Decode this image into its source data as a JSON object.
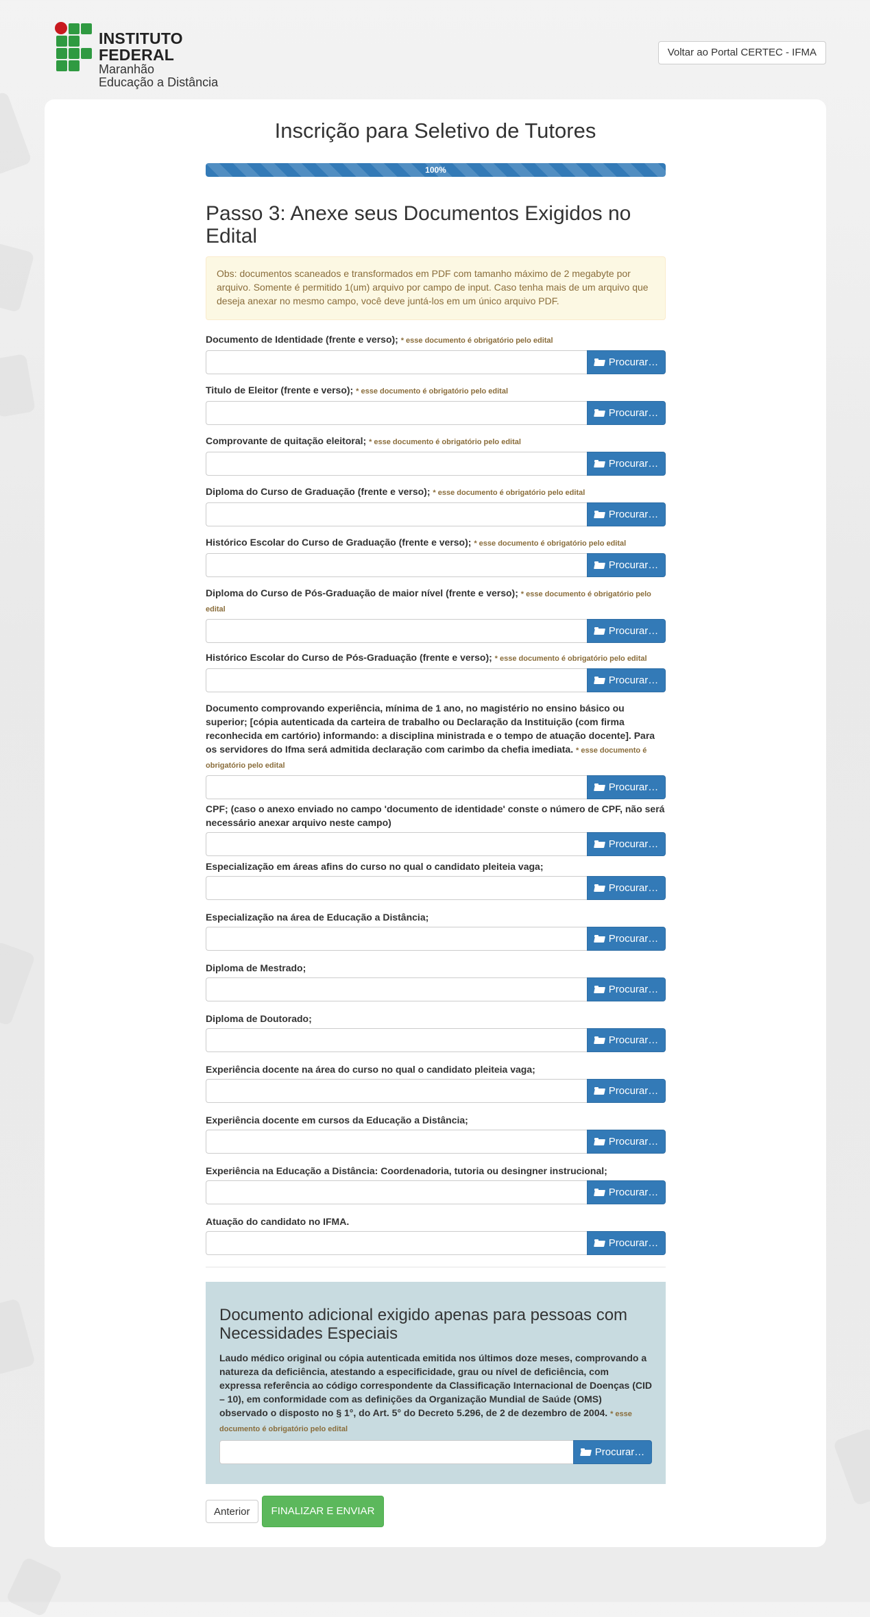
{
  "header": {
    "logo": {
      "title": "INSTITUTO FEDERAL",
      "line1": "Maranhão",
      "line2": "Educação a Distância"
    },
    "portal_button": "Voltar ao Portal CERTEC - IFMA"
  },
  "form": {
    "title": "Inscrição para Seletivo de Tutores",
    "progress": {
      "label": "100%",
      "percent": 100
    },
    "step_title": "Passo 3: Anexe seus Documentos Exigidos no Edital",
    "notice": "Obs: documentos scaneados e transformados em PDF com tamanho máximo de 2 megabyte por arquivo. Somente é permitido 1(um) arquivo por campo de input. Caso tenha mais de um arquivo que deseja anexar no mesmo campo, você deve juntá-los em um único arquivo PDF.",
    "browse_label": "Procurar…",
    "required_note": "* esse documento é obrigatório pelo edital",
    "fields": [
      {
        "label": "Documento de Identidade (frente e verso);",
        "note": "* esse documento é obrigatório pelo edital"
      },
      {
        "label": "Titulo de Eleitor (frente e verso);",
        "note": "* esse documento é obrigatório pelo edital"
      },
      {
        "label": "Comprovante de quitação eleitoral;",
        "note": "* esse documento é obrigatório pelo edital"
      },
      {
        "label": "Diploma do Curso de Graduação (frente e verso);",
        "note": "* esse documento é obrigatório pelo edital"
      },
      {
        "label": "Histórico Escolar do Curso de Graduação (frente e verso);",
        "note": "* esse documento é obrigatório pelo edital"
      },
      {
        "label": "Diploma do Curso de Pós-Graduação de maior nível (frente e verso);",
        "note": "* esse documento é obrigatório pelo edital"
      },
      {
        "label": "Histórico Escolar do Curso de Pós-Graduação (frente e verso);",
        "note": "* esse documento é obrigatório pelo edital"
      },
      {
        "label": "Documento comprovando experiência, mínima de 1 ano, no magistério no ensino básico ou superior;",
        "detail": "[cópia autenticada da carteira de trabalho ou Declaração da Instituição (com firma reconhecida em cartório) informando: a disciplina ministrada e o tempo de atuação docente]. Para os servidores do Ifma será admitida declaração com carimbo da chefia imediata.",
        "note": "* esse documento é obrigatório pelo edital"
      },
      {
        "label": "CPF;",
        "detail": "(caso o anexo enviado no campo 'documento de identidade' conste o número de CPF, não será necessário anexar arquivo neste campo)"
      },
      {
        "label": "Especialização em áreas afins do curso no qual o candidato pleiteia vaga;"
      },
      {
        "label": "Especialização na área de Educação a Distância;"
      },
      {
        "label": "Diploma de Mestrado;"
      },
      {
        "label": "Diploma de Doutorado;"
      },
      {
        "label": "Experiência docente na área do curso no qual o candidato pleiteia vaga;"
      },
      {
        "label": "Experiência docente em cursos da Educação a Distância;"
      },
      {
        "label": "Experiência na Educação a Distância: Coordenadoria, tutoria ou desingner instrucional;"
      },
      {
        "label": "Atuação do candidato no IFMA."
      }
    ],
    "special": {
      "title": "Documento adicional exigido apenas para pessoas com Necessidades Especiais",
      "text": "Laudo médico original ou cópia autenticada emitida nos últimos doze meses, comprovando a natureza da deficiência, atestando a especificidade, grau ou nível de deficiência, com expressa referência ao código correspondente da Classificação Internacional de Doenças (CID – 10), em conformidade com as definições da Organização Mundial de Saúde (OMS) observado o disposto no § 1°, do Art. 5° do Decreto 5.296, de 2 de dezembro de 2004.",
      "note": "* esse documento é obrigatório pelo edital"
    },
    "buttons": {
      "previous": "Anterior",
      "submit": "FINALIZAR E ENVIAR"
    }
  },
  "colors": {
    "primary": "#337ab7",
    "success": "#5cb85c",
    "warning_bg": "#fcf8e3",
    "warning_text": "#8a6d3b",
    "special_bg": "#c8dbe0",
    "logo_green": "#2f9a41",
    "logo_red": "#c8191e"
  },
  "icons": {
    "browse": "folder-open-icon"
  }
}
